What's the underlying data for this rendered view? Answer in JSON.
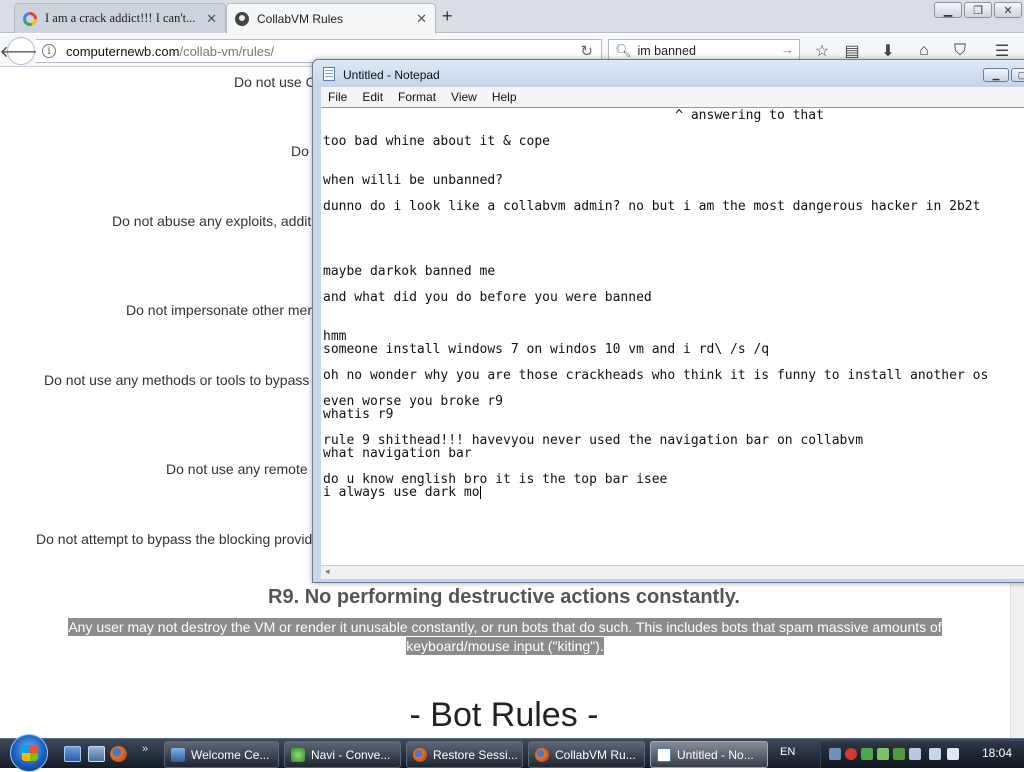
{
  "browser": {
    "tabs": [
      {
        "title": "I am a crack addict!!! I can't...",
        "icon": "google-icon",
        "active": false
      },
      {
        "title": "CollabVM Rules",
        "icon": "collabvm-icon",
        "active": true
      }
    ],
    "new_tab": "+",
    "address": {
      "host": "computernewb.com",
      "path": "/collab-vm/rules/"
    },
    "search": {
      "value": "im banned"
    }
  },
  "page": {
    "rules": [
      "Do not use C",
      "Do",
      "Do not abuse any exploits, addit",
      "Do not impersonate other mer",
      "Do not use any methods or tools to bypass",
      "Do not use any remote",
      "Do not attempt to bypass the blocking provid"
    ],
    "r9_heading": "R9. No performing destructive actions constantly.",
    "r9_body_line1": "Any user may not destroy the VM or render it unusable constantly, or run bots that do such. This includes bots that spam massive amounts of",
    "r9_body_line2": "keyboard/mouse input (\"kiting\").",
    "bot_rules_heading": "- Bot Rules -"
  },
  "notepad": {
    "title": "Untitled - Notepad",
    "menu": [
      "File",
      "Edit",
      "Format",
      "View",
      "Help"
    ],
    "lines": [
      "                                             ^ answering to that",
      "too bad whine about it & cope",
      "when willi be unbanned?",
      "dunno do i look like a collabvm admin? no but i am the most dangerous hacker in 2b2t",
      "maybe darkok banned me",
      "and what did you do before you were banned",
      "hmm",
      "someone install windows 7 on windos 10 vm and i rd\\ /s /q",
      "oh no wonder why you are those crackheads who think it is funny to install another os",
      "even worse you broke r9",
      "whatis r9",
      "rule 9 shithead!!! havevyou never used the navigation bar on collabvm",
      "what navigation bar",
      "do u know english bro it is the top bar isee",
      "i always use dark mo"
    ]
  },
  "taskbar": {
    "tasks": [
      {
        "label": "Welcome Ce...",
        "icon": "welcome-center-icon",
        "active": false
      },
      {
        "label": "Navi - Conve...",
        "icon": "chat-icon",
        "active": false
      },
      {
        "label": "Restore Sessi...",
        "icon": "firefox-icon",
        "active": false
      },
      {
        "label": "CollabVM Ru...",
        "icon": "firefox-icon",
        "active": false
      },
      {
        "label": "Untitled - No...",
        "icon": "notepad-icon",
        "active": true
      }
    ],
    "language": "EN",
    "clock": "18:04"
  }
}
